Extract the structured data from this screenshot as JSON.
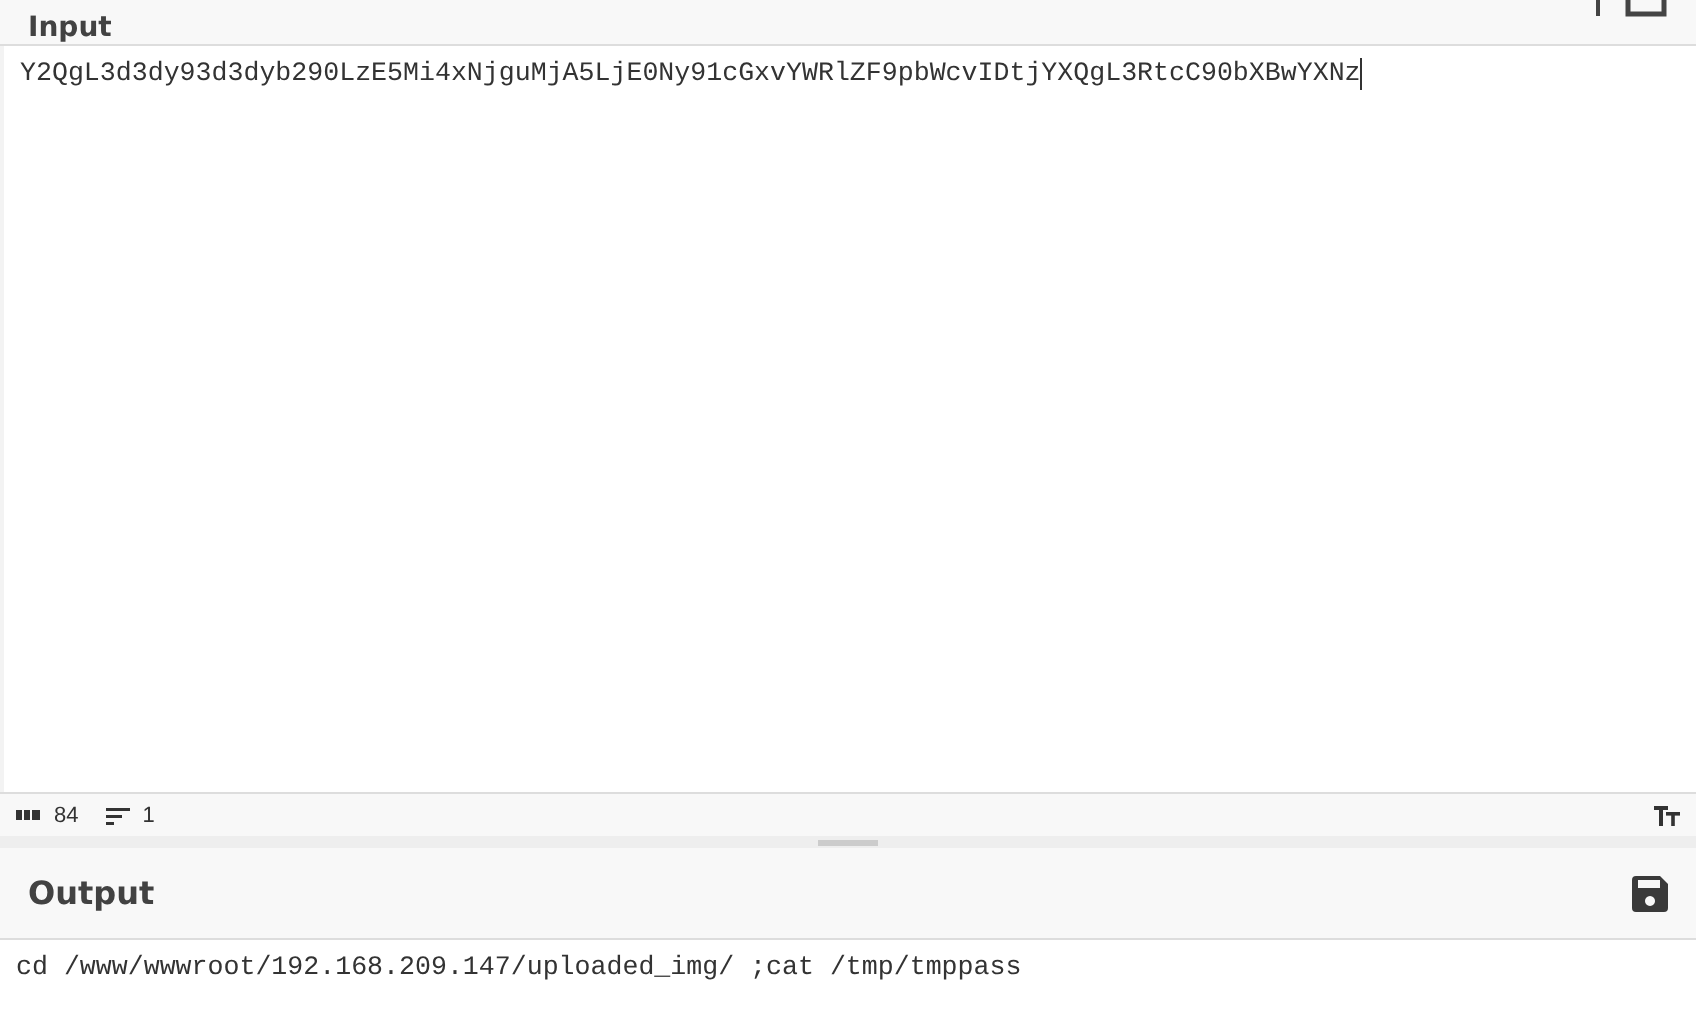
{
  "input": {
    "title": "Input",
    "value": "Y2QgL3d3dy93d3dyb290LzE5Mi4xNjguMjA5LjE0Ny91cGxvYWRlZF9pbWcvIDtjYXQgL3RtcC90bXBwYXNz"
  },
  "status_bar": {
    "length": "84",
    "lines": "1"
  },
  "output": {
    "title": "Output",
    "value": "cd /www/wwwroot/192.168.209.147/uploaded_img/ ;cat /tmp/tmppass"
  }
}
